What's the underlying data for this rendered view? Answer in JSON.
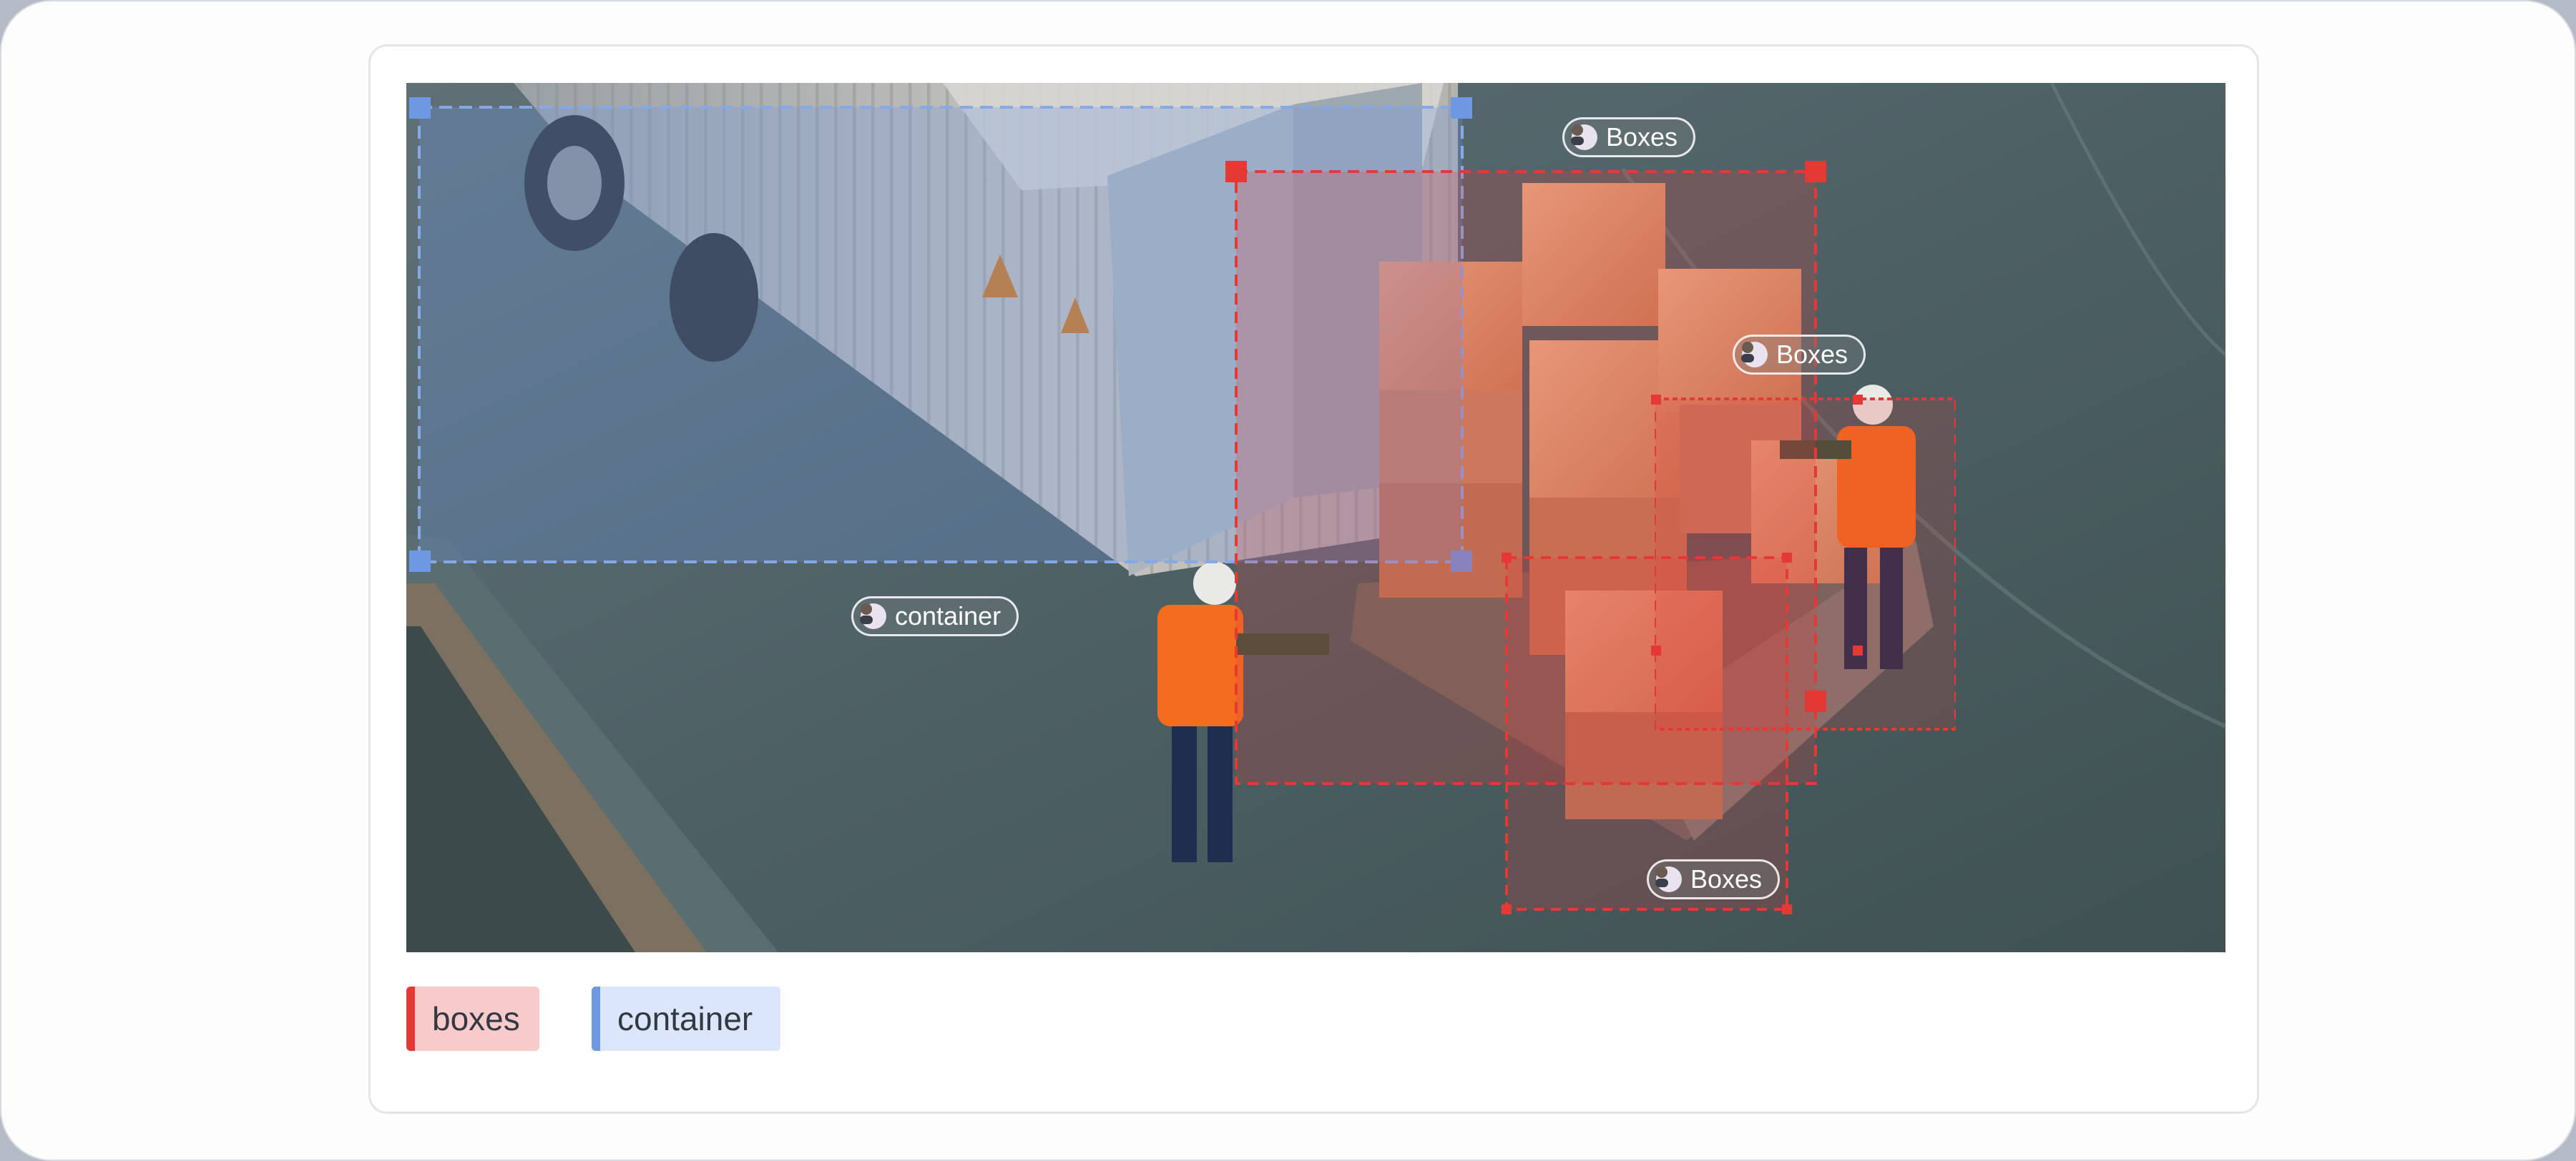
{
  "colors": {
    "boxes": "#e53935",
    "boxes_fill": "#f8caca",
    "container": "#6f98e3",
    "container_fill": "#dbe6fa"
  },
  "annotations": [
    {
      "label": "container",
      "class": "container",
      "icon": "avatar-icon"
    },
    {
      "label": "Boxes",
      "class": "boxes",
      "icon": "avatar-icon"
    },
    {
      "label": "Boxes",
      "class": "boxes",
      "icon": "avatar-icon"
    },
    {
      "label": "Boxes",
      "class": "boxes",
      "icon": "avatar-icon"
    }
  ],
  "legend": [
    {
      "label": "boxes",
      "class": "boxes"
    },
    {
      "label": "container",
      "class": "container"
    }
  ]
}
